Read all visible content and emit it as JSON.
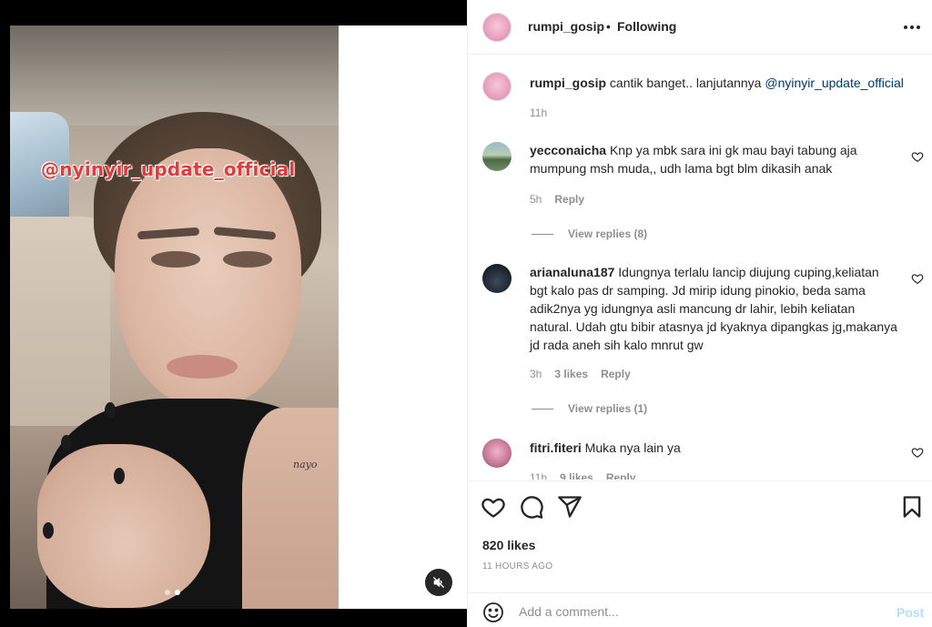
{
  "media": {
    "watermark": "@nyinyir_update_official",
    "tattoo_text": "nayo",
    "slide_count": 2,
    "active_slide": 2
  },
  "post": {
    "username": "rumpi_gosip",
    "separator": "•",
    "follow_status": "Following",
    "caption": {
      "username": "rumpi_gosip",
      "text": "cantik banget.. lanjutannya",
      "mention": "@nyinyir_update_official",
      "time": "11h"
    },
    "comments": [
      {
        "username": "yecconaicha",
        "text": "Knp ya mbk sara ini gk mau bayi tabung aja mumpung msh muda,, udh lama bgt blm dikasih anak",
        "time": "5h",
        "likes": "",
        "reply_label": "Reply",
        "view_replies": "View replies (8)"
      },
      {
        "username": "arianaluna187",
        "text": "Idungnya terlalu lancip diujung cuping,keliatan bgt kalo pas dr samping. Jd mirip idung pinokio, beda sama adik2nya yg idungnya asli mancung dr lahir, lebih keliatan natural. Udah gtu bibir atasnya jd kyaknya dipangkas jg,makanya jd rada aneh sih kalo mnrut gw",
        "time": "3h",
        "likes": "3 likes",
        "reply_label": "Reply",
        "view_replies": "View replies (1)"
      },
      {
        "username": "fitri.fiteri",
        "text": "Muka nya lain ya",
        "time": "11h",
        "likes": "9 likes",
        "reply_label": "Reply",
        "view_replies": ""
      }
    ],
    "likes_count": "820 likes",
    "time_ago": "11 HOURS AGO",
    "add_comment_placeholder": "Add a comment...",
    "post_label": "Post"
  },
  "icons": {
    "more": "more-options-icon",
    "like": "heart-icon",
    "comment": "comment-bubble-icon",
    "share": "paper-plane-icon",
    "save": "bookmark-icon",
    "emoji": "smiley-icon",
    "mute": "speaker-muted-icon"
  },
  "colors": {
    "mention": "#00376b",
    "watermark": "#e23b3b",
    "post_disabled": "#b2dffc",
    "secondary_text": "#8e8e8e"
  }
}
